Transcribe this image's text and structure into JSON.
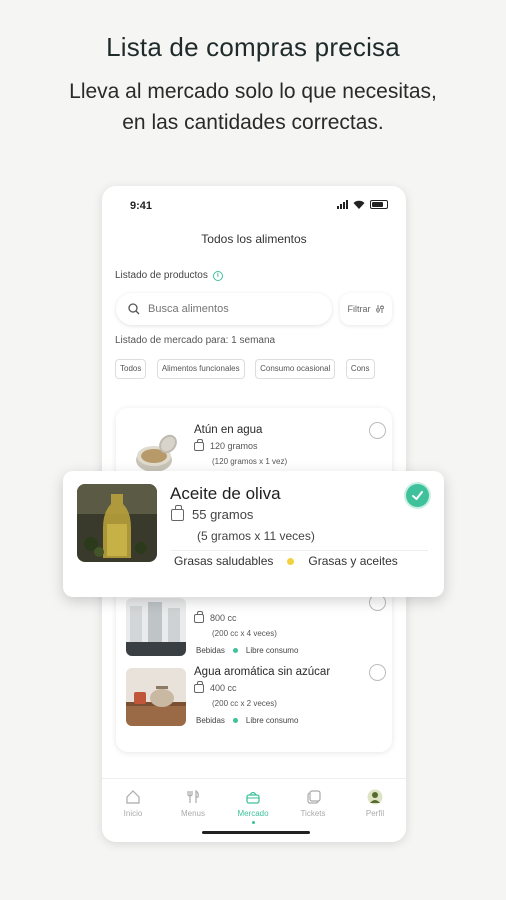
{
  "promo": {
    "title": "Lista de compras precisa",
    "subtitle_line1": "Lleva al mercado solo lo que necesitas,",
    "subtitle_line2": "en las cantidades correctas."
  },
  "status_bar": {
    "time": "9:41"
  },
  "header": {
    "title": "Todos los alimentos"
  },
  "products": {
    "label": "Listado de productos",
    "info_icon": "i"
  },
  "search": {
    "placeholder": "Busca alimentos",
    "value": ""
  },
  "filter": {
    "label": "Filtrar"
  },
  "market": {
    "label": "Listado de mercado para: 1 semana"
  },
  "chips": [
    "Todos",
    "Alimentos funcionales",
    "Consumo ocasional",
    "Cons"
  ],
  "items": [
    {
      "name": "Atún en agua",
      "qty": "120 gramos",
      "calc": "(120 gramos x 1 vez)",
      "tag1": "",
      "tag2": ""
    },
    {
      "name": "",
      "qty": "800 cc",
      "calc": "(200 cc x 4 veces)",
      "tag1": "Bebidas",
      "tag2": "Libre consumo"
    },
    {
      "name": "Agua aromática sin azúcar",
      "qty": "400 cc",
      "calc": "(200 cc x 2 veces)",
      "tag1": "Bebidas",
      "tag2": "Libre consumo"
    }
  ],
  "highlight": {
    "name": "Aceite de oliva",
    "qty": "55 gramos",
    "calc": "(5 gramos x 11 veces)",
    "tag1": "Grasas saludables",
    "tag2": "Grasas y aceites",
    "checked": true
  },
  "nav": [
    {
      "label": "Inicio",
      "icon": "home-icon"
    },
    {
      "label": "Menus",
      "icon": "cutlery-icon"
    },
    {
      "label": "Mercado",
      "icon": "basket-icon",
      "active": true
    },
    {
      "label": "Tickets",
      "icon": "tickets-icon"
    },
    {
      "label": "Perfil",
      "icon": "avatar-icon"
    }
  ],
  "colors": {
    "accent": "#3fc19b",
    "yellow_tag": "#f2d23c",
    "background": "#f5f5f4"
  }
}
